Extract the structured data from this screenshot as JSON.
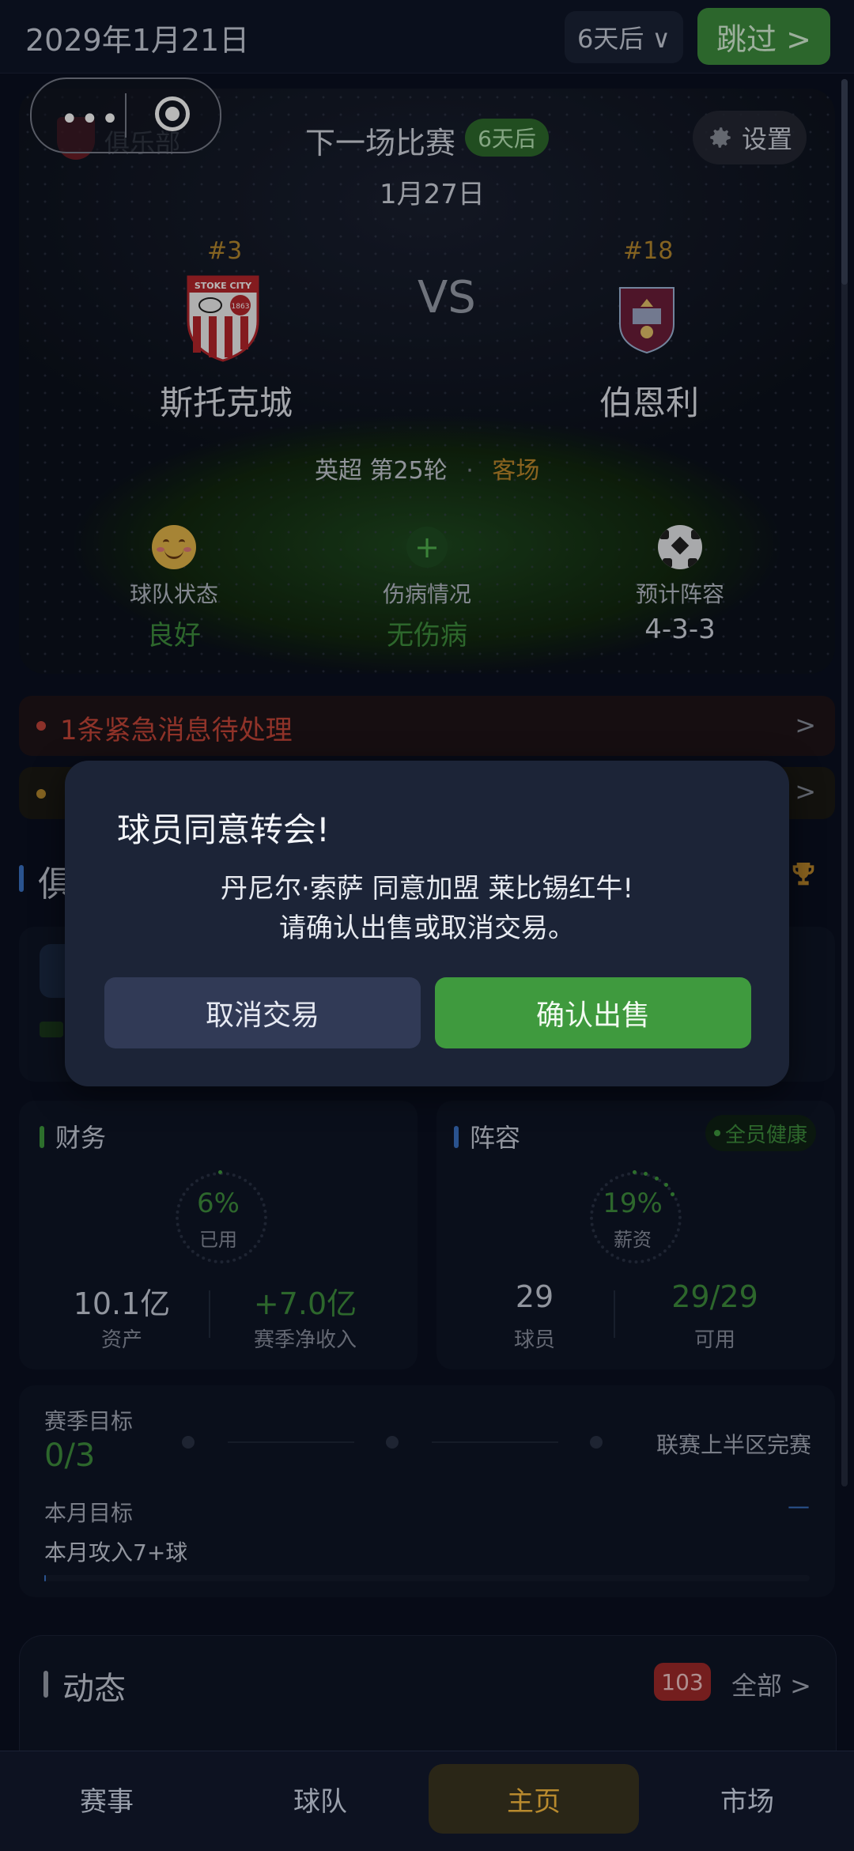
{
  "header": {
    "date": "2029年1月21日",
    "days_selector": "6天后 ∨",
    "skip_button": "跳过 >"
  },
  "hero": {
    "club_label": "俱乐部",
    "next_match_title": "下一场比赛",
    "days_badge": "6天后",
    "match_date": "1月27日",
    "settings_label": "设置",
    "home_team": {
      "rank": "#3",
      "name": "斯托克城",
      "crest_text": "STOKE CITY",
      "crest_year": "1863"
    },
    "vs": "VS",
    "away_team": {
      "rank": "#18",
      "name": "伯恩利"
    },
    "league_round": "英超 第25轮",
    "separator": "·",
    "venue": "客场",
    "stats": [
      {
        "label": "球队状态",
        "value": "良好",
        "icon": "smile-face-icon"
      },
      {
        "label": "伤病情况",
        "value": "无伤病",
        "icon": "medical-plus-icon"
      },
      {
        "label": "预计阵容",
        "value": "4-3-3",
        "icon": "soccer-ball-icon"
      }
    ]
  },
  "alerts": [
    {
      "text": "1条紧急消息待处理",
      "chevron": ">"
    },
    {
      "text": "",
      "chevron": ">"
    }
  ],
  "club_section": {
    "title": "俱"
  },
  "modal": {
    "title": "球员同意转会!",
    "line1": "丹尼尔·索萨 同意加盟 莱比锡红牛!",
    "line2": "请确认出售或取消交易。",
    "cancel_label": "取消交易",
    "confirm_label": "确认出售"
  },
  "finance": {
    "title": "财务",
    "ring_pct": "6%",
    "ring_label": "已用",
    "ring_value": 0.06,
    "assets_value": "10.1亿",
    "assets_label": "资产",
    "net_income_value": "+7.0亿",
    "net_income_label": "赛季净收入"
  },
  "squad": {
    "title": "阵容",
    "health_badge": "全员健康",
    "ring_pct": "19%",
    "ring_label": "薪资",
    "ring_value": 0.19,
    "players_value": "29",
    "players_label": "球员",
    "available_value": "29/29",
    "available_label": "可用"
  },
  "goals": {
    "season_label": "赛季目标",
    "season_progress": "0/3",
    "season_goal": "联赛上半区完赛",
    "month_label": "本月目标",
    "month_goal": "本月攻入7+球",
    "month_dash": "—"
  },
  "feed": {
    "title": "动态",
    "count": "103",
    "all_label": "全部 >"
  },
  "nav": [
    {
      "label": "赛事"
    },
    {
      "label": "球队"
    },
    {
      "label": "主页",
      "active": true
    },
    {
      "label": "市场"
    }
  ],
  "colors": {
    "accent_green": "#3f9a3e",
    "accent_gold": "#b88a2e",
    "alert_red": "#c8473a",
    "background": "#0b1020"
  }
}
